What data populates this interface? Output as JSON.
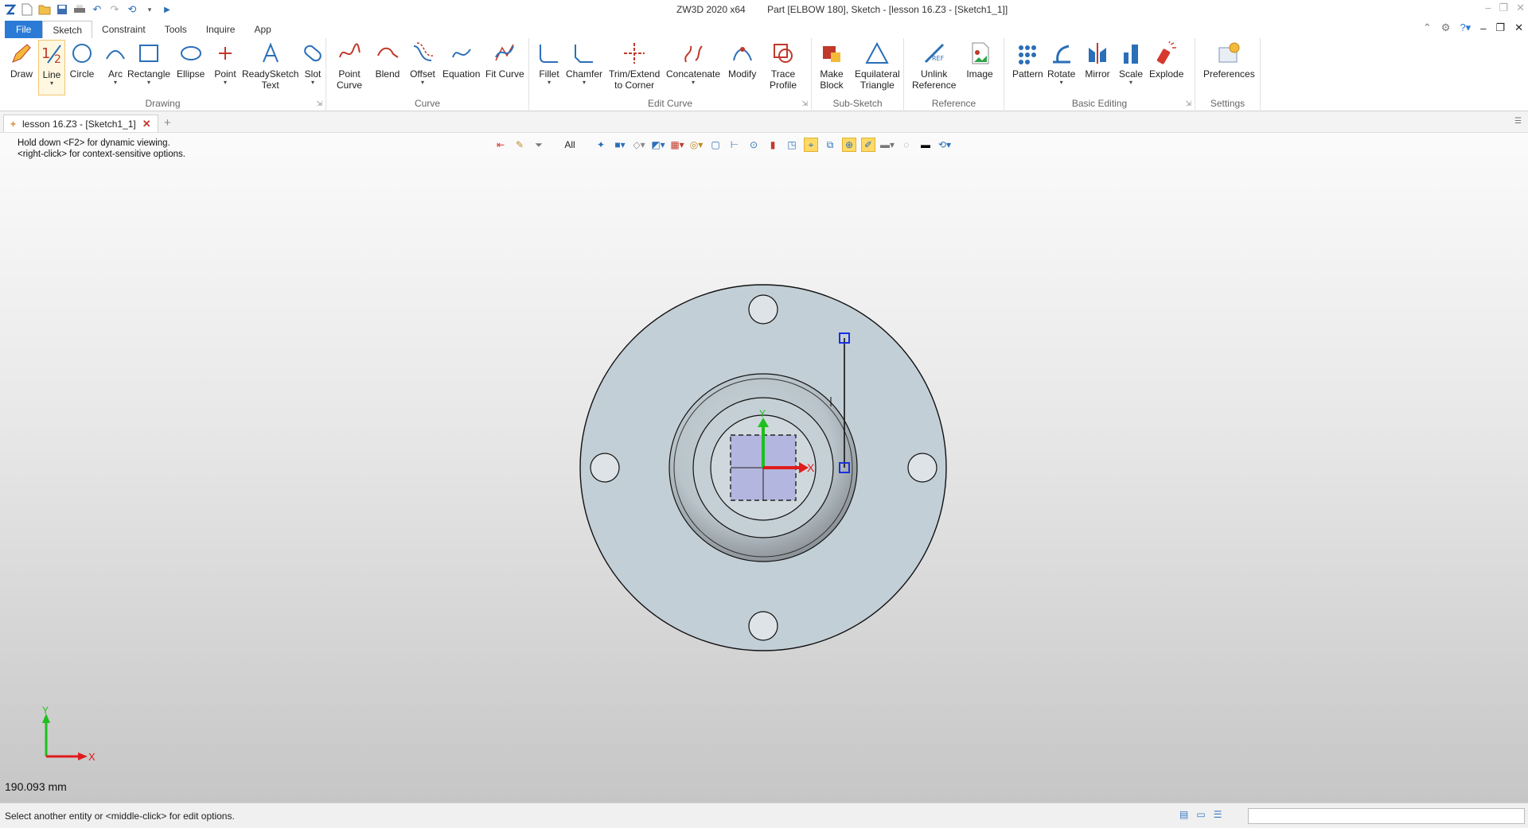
{
  "window": {
    "app": "ZW3D 2020 x64",
    "document": "Part [ELBOW 180],  Sketch - [lesson 16.Z3 - [Sketch1_1]]"
  },
  "ribbon_tabs": [
    "File",
    "Sketch",
    "Constraint",
    "Tools",
    "Inquire",
    "App"
  ],
  "groups": {
    "drawing": "Drawing",
    "curve": "Curve",
    "edit_curve": "Edit Curve",
    "sub_sketch": "Sub-Sketch",
    "reference": "Reference",
    "basic_editing": "Basic Editing",
    "settings": "Settings"
  },
  "buttons": {
    "draw": "Draw",
    "line": "Line",
    "circle": "Circle",
    "arc": "Arc",
    "rectangle": "Rectangle",
    "ellipse": "Ellipse",
    "point": "Point",
    "readysketch_1": "ReadySketch",
    "readysketch_2": "Text",
    "slot": "Slot",
    "point_curve_1": "Point",
    "point_curve_2": "Curve",
    "blend": "Blend",
    "offset": "Offset",
    "equation": "Equation",
    "fit_curve": "Fit Curve",
    "fillet": "Fillet",
    "chamfer": "Chamfer",
    "trim_1": "Trim/Extend",
    "trim_2": "to Corner",
    "concatenate": "Concatenate",
    "modify": "Modify",
    "trace_1": "Trace",
    "trace_2": "Profile",
    "make_block_1": "Make",
    "make_block_2": "Block",
    "equilateral_1": "Equilateral",
    "equilateral_2": "Triangle",
    "unlink_1": "Unlink",
    "unlink_2": "Reference",
    "image": "Image",
    "pattern": "Pattern",
    "rotate": "Rotate",
    "mirror": "Mirror",
    "scale": "Scale",
    "explode": "Explode",
    "preferences": "Preferences"
  },
  "doc_tab": "lesson 16.Z3 - [Sketch1_1]",
  "hint": {
    "line1": "Hold down <F2> for dynamic viewing.",
    "line2": "<right-click> for context-sensitive options."
  },
  "view_filter": "All",
  "axis": {
    "x": "X",
    "y": "Y"
  },
  "scale_readout": "190.093 mm",
  "status_message": "Select another entity or <middle-click> for edit options.",
  "colors": {
    "accent": "#2b7bd6",
    "part_fill": "#c2cfd6",
    "selection": "#1a2fe0",
    "axis_x": "#e01b1b",
    "axis_y": "#1fbf1f"
  }
}
